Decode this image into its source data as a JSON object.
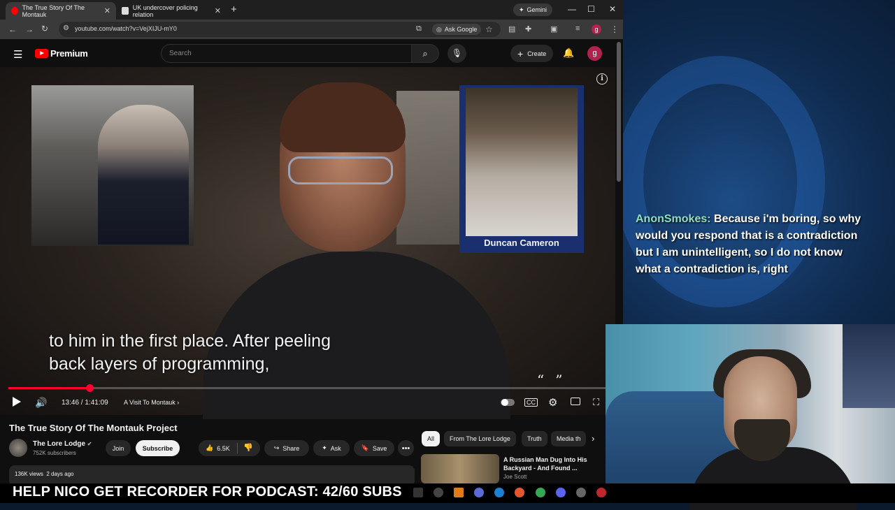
{
  "browser": {
    "tabs": [
      {
        "title": "The True Story Of The Montauk",
        "favicon_color": "#ff0000"
      },
      {
        "title": "UK undercover policing relation",
        "favicon_color": "#dcdcdc"
      }
    ],
    "new_tab_label": "+",
    "gemini_label": "Gemini",
    "url": "youtube.com/watch?v=VejXIJU-mY0",
    "ask_google_label": "Ask Google",
    "profile_initial": "g"
  },
  "youtube": {
    "logo_label": "Premium",
    "search_placeholder": "Search",
    "create_label": "Create",
    "avatar_initial": "g",
    "player": {
      "caption_line1": "to him in the first place. After peeling",
      "caption_line2": "back layers of programming,",
      "overlay_name": "Duncan Cameron",
      "time": "13:46 / 1:41:09",
      "chapter": "A Visit To Montauk",
      "progress_fraction": 0.136,
      "cc_label": "CC"
    },
    "video_title": "The True Story Of The Montauk Project",
    "channel": {
      "name": "The Lore Lodge",
      "subscribers": "752K subscribers",
      "join_label": "Join",
      "subscribe_label": "Subscribe"
    },
    "actions": {
      "likes": "6.5K",
      "share": "Share",
      "ask": "Ask",
      "save": "Save"
    },
    "views_line": "136K views  2 days ago",
    "chips": [
      "All",
      "From The Lore Lodge",
      "Truth",
      "Media th"
    ],
    "recommendation": {
      "title": "A Russian Man Dug Into His Backyard - And Found ...",
      "channel": "Joe Scott"
    }
  },
  "stream_overlay": {
    "chat_user": "AnonSmokes:",
    "chat_message": "Because i'm boring, so why would you respond that is a contradiction but I am unintelligent, so I do not know what a contradiction is, right",
    "banner": "HELP NICO GET RECORDER FOR PODCAST: 42/60 SUBS"
  },
  "colors": {
    "yt_red": "#ff0000",
    "progress_red": "#ff0033",
    "chat_user": "#8ee0c0",
    "avatar": "#b0234e"
  }
}
